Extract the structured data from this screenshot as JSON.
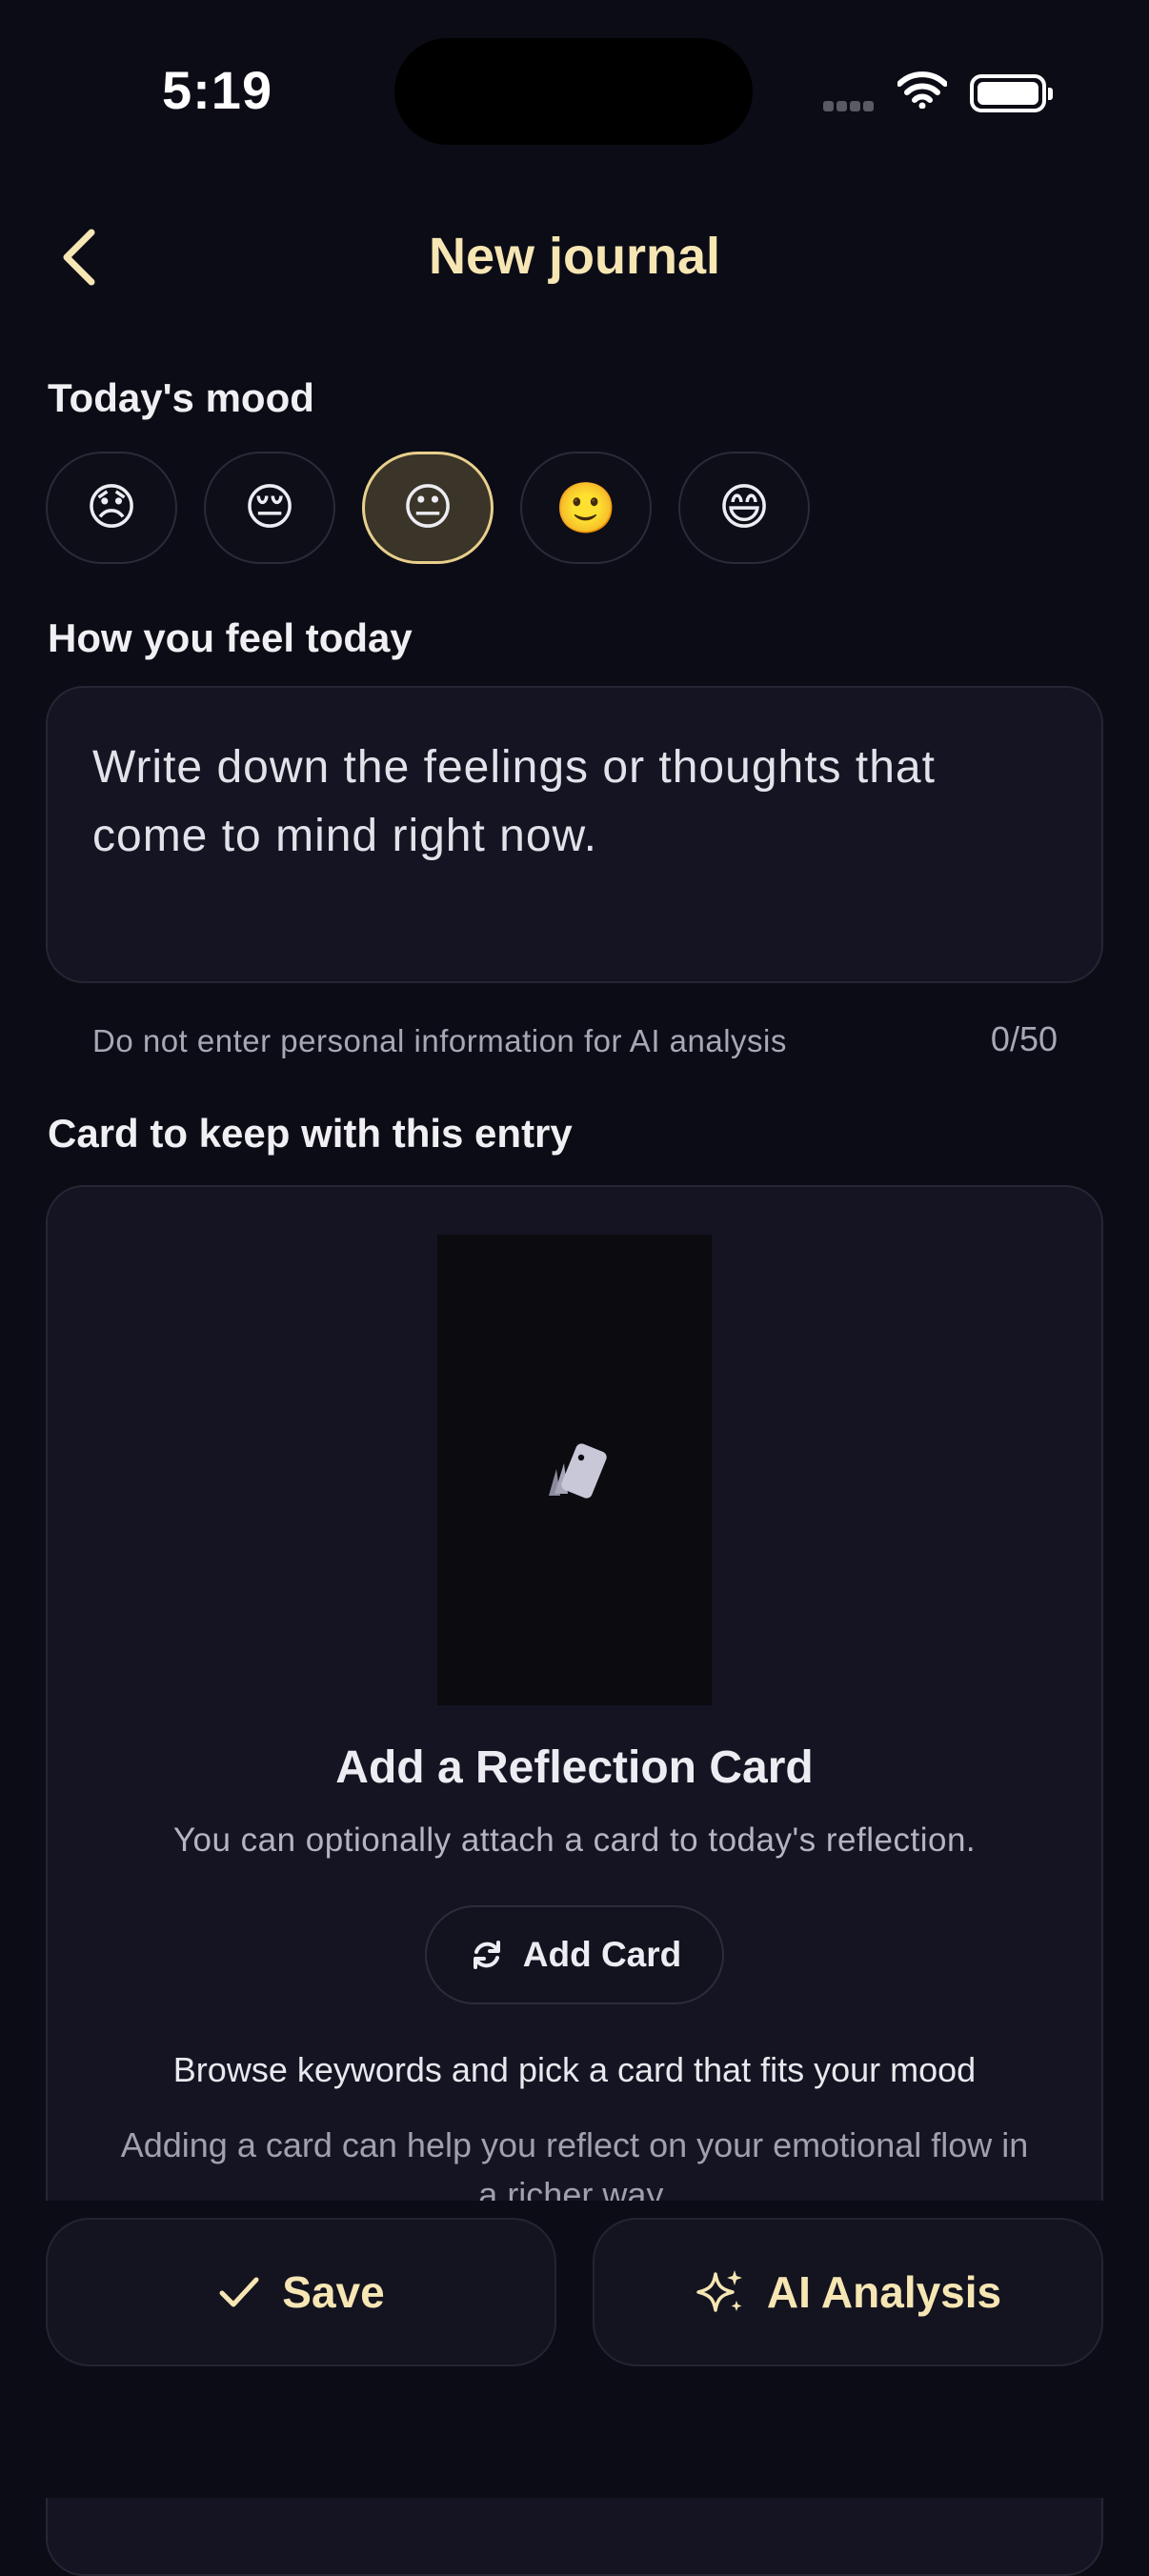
{
  "status_bar": {
    "time": "5:19"
  },
  "header": {
    "title": "New journal"
  },
  "mood": {
    "label": "Today's mood",
    "options": [
      "😞",
      "😔",
      "😐",
      "🙂",
      "😄"
    ],
    "selected_index": 2
  },
  "feel": {
    "label": "How you feel today",
    "placeholder": "Write down the feelings or thoughts that come to mind right now.",
    "hint": "Do not enter personal information for AI analysis",
    "counter": "0/50"
  },
  "card": {
    "section_label": "Card to keep with this entry",
    "title": "Add a Reflection Card",
    "subtitle": "You can optionally attach a card to today's reflection.",
    "add_button": "Add Card",
    "browse_text": "Browse keywords and pick a card that fits your mood",
    "adding_text": "Adding a card can help you reflect on your emotional flow in a richer way."
  },
  "actions": {
    "save": "Save",
    "ai_analysis": "AI Analysis"
  },
  "colors": {
    "background": "#0c0c16",
    "accent": "#f6e6b4",
    "selected_border": "#e9cf8c"
  }
}
